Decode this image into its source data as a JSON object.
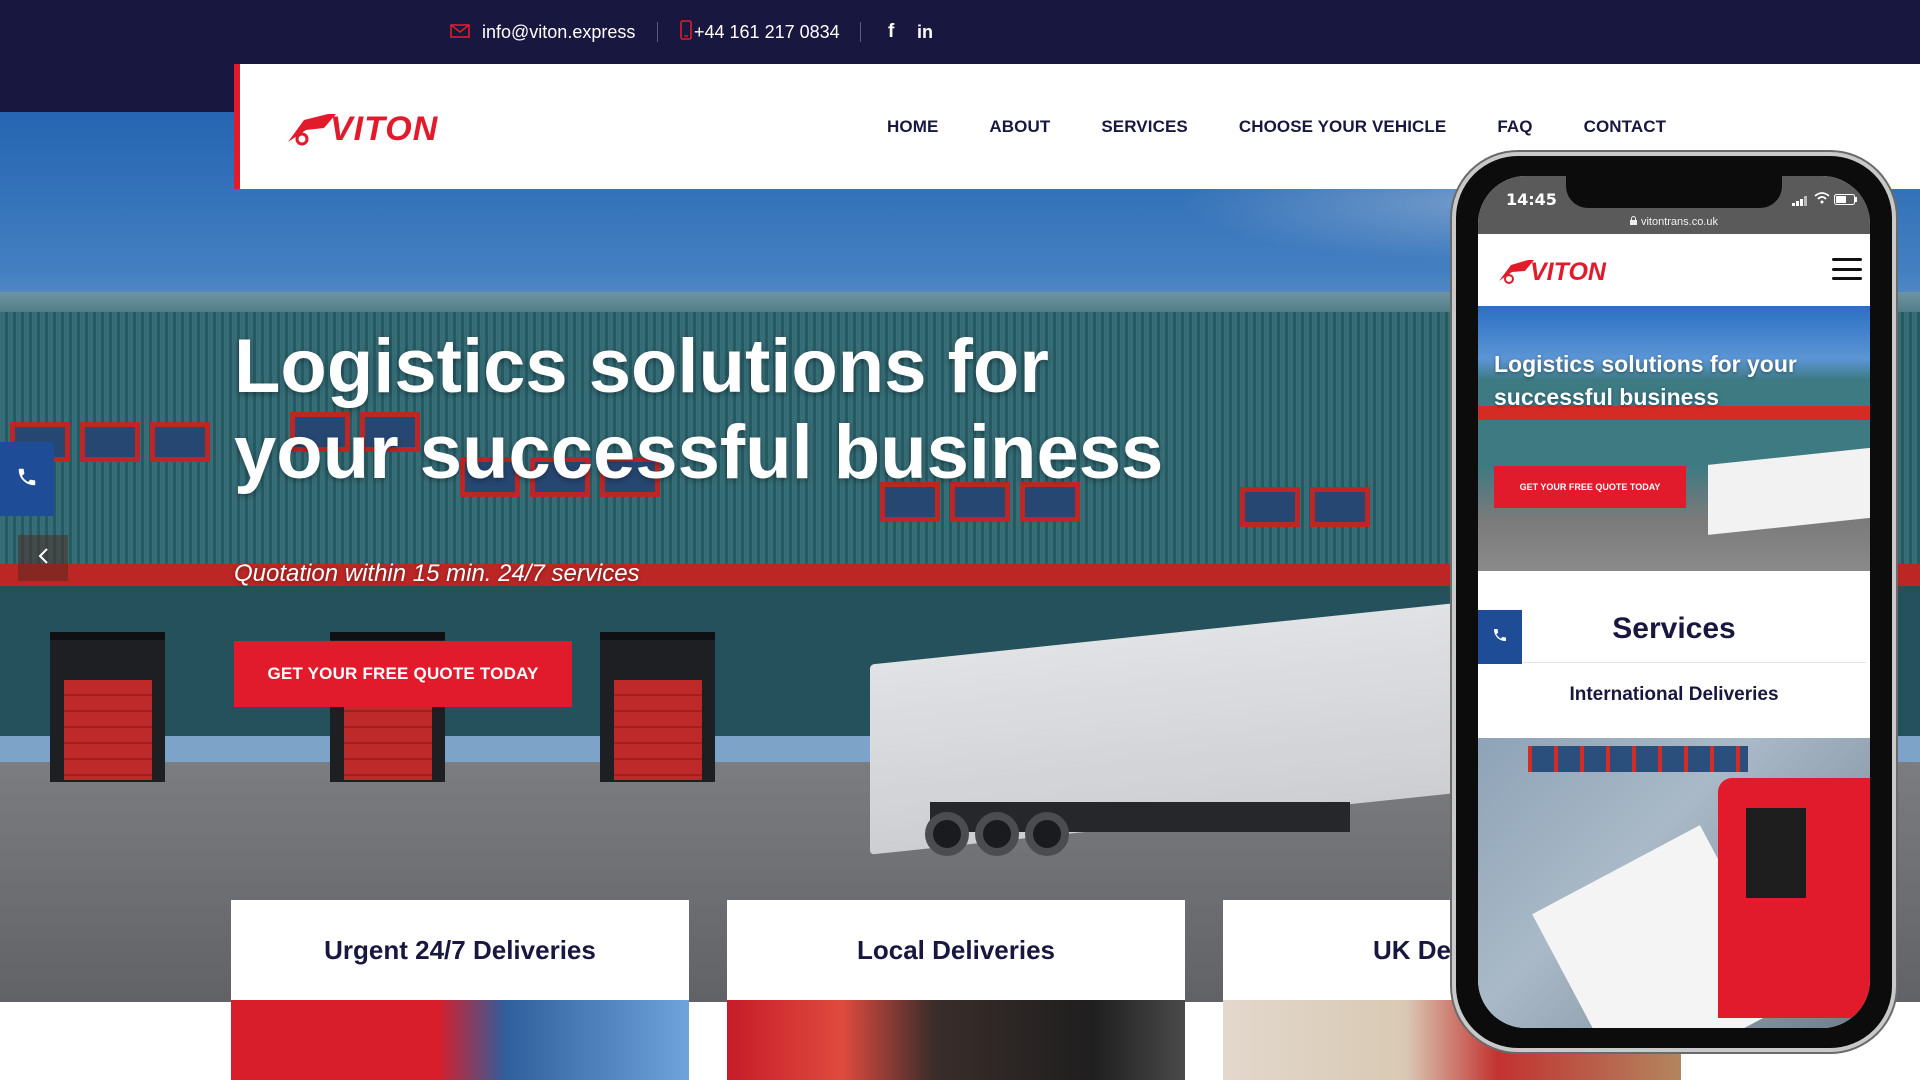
{
  "topbar": {
    "email": "info@viton.express",
    "phone": "+44 161 217 0834",
    "social": [
      "facebook-icon",
      "linkedin-icon"
    ]
  },
  "brand": {
    "logo_text": "VITON",
    "accent_color": "#e21b2c",
    "navy_color": "#17173f",
    "blue_color": "#1f4c96"
  },
  "nav": {
    "items": [
      "HOME",
      "ABOUT",
      "SERVICES",
      "CHOOSE YOUR VEHICLE",
      "FAQ",
      "CONTACT"
    ]
  },
  "hero": {
    "title": "Logistics solutions for your successful business",
    "subtitle": "Quotation within 15 min. 24/7 services",
    "cta": "GET YOUR FREE QUOTE TODAY"
  },
  "cards": [
    {
      "title": "Urgent 24/7 Deliveries"
    },
    {
      "title": "Local Deliveries"
    },
    {
      "title": "UK Del"
    }
  ],
  "mobile": {
    "time": "14:45",
    "url": "vitontrans.co.uk",
    "hero_title": "Logistics solutions for your successful business",
    "hero_cta": "GET YOUR FREE QUOTE TODAY",
    "services_title": "Services",
    "first_service": "International Deliveries"
  }
}
